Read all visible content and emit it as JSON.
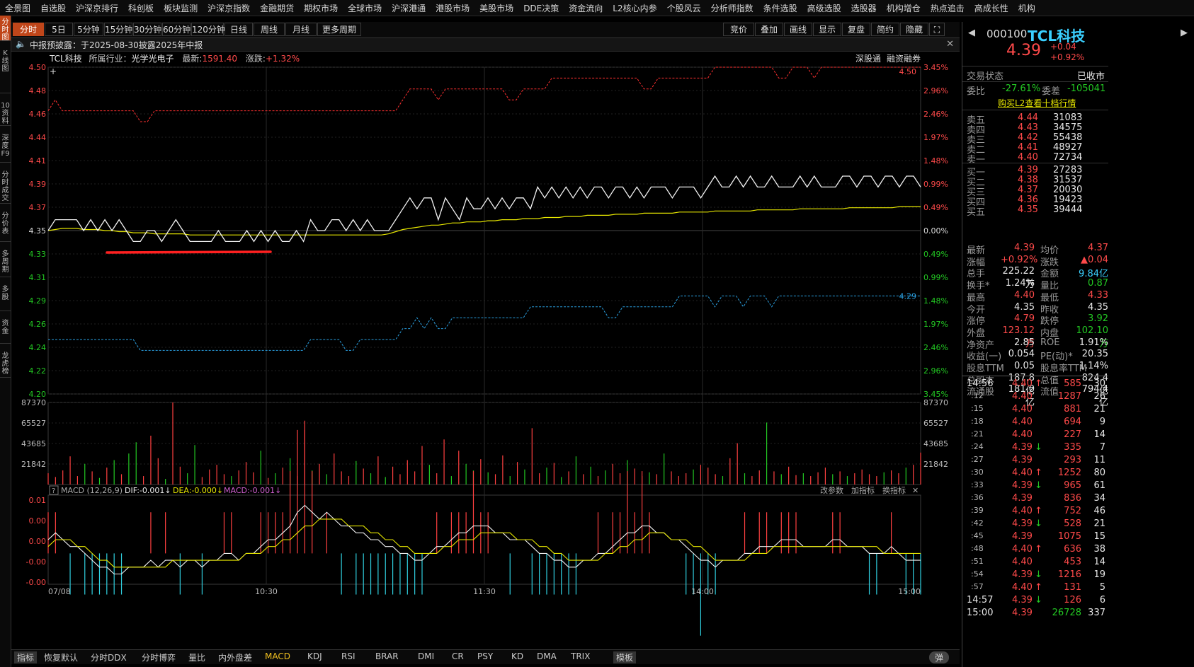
{
  "menu": [
    "全景图",
    "自选股",
    "沪深京排行",
    "科创板",
    "板块监测",
    "沪深京指数",
    "金融期货",
    "期权市场",
    "全球市场",
    "沪深港通",
    "港股市场",
    "美股市场",
    "DDE决策",
    "资金流向",
    "L2核心内参",
    "个股风云",
    "分析师指数",
    "条件选股",
    "高级选股",
    "选股器",
    "机构增仓",
    "热点追击",
    "高成长性",
    "机构"
  ],
  "left_tabs": [
    "分时图",
    "K线图",
    "10资料",
    "深度F9",
    "分时成交",
    "分价表",
    "多周期",
    "多股",
    "资金",
    "龙虎榜"
  ],
  "periods": [
    "分时",
    "5日",
    "5分钟",
    "15分钟",
    "30分钟",
    "60分钟",
    "120分钟",
    "日线",
    "周线",
    "月线",
    "更多周期"
  ],
  "right_tools": [
    "竞价",
    "叠加",
    "画线",
    "显示",
    "复盘",
    "简约",
    "隐藏",
    "⛶"
  ],
  "notice": {
    "text": "中报预披露：于2025-08-30披露2025年中报",
    "close": "✕"
  },
  "info": {
    "name": "TCL科技",
    "industry_label": "所属行业：",
    "industry": "光学光电子",
    "latest_label": "最新:",
    "latest": "1591.40",
    "change_label": "涨跌:",
    "change": "+1.32%",
    "link1": "深股通",
    "link2": "融资融券"
  },
  "price_axis": [
    "4.50",
    "4.48",
    "4.46",
    "4.44",
    "4.41",
    "4.39",
    "4.37",
    "4.35",
    "4.33",
    "4.31",
    "4.29",
    "4.26",
    "4.24",
    "4.22",
    "4.20"
  ],
  "pct_axis": [
    "3.45%",
    "2.96%",
    "2.46%",
    "1.97%",
    "1.48%",
    "0.99%",
    "0.49%",
    "0.00%",
    "0.49%",
    "0.99%",
    "1.48%",
    "1.97%",
    "2.46%",
    "2.96%",
    "3.45%"
  ],
  "vol_axis": [
    "87370",
    "65527",
    "43685",
    "21842"
  ],
  "macd_axis": [
    "0.01",
    "0.00",
    "0.00",
    "-0.00",
    "-0.00"
  ],
  "times": [
    "07/08",
    "10:30",
    "11:30",
    "14:00",
    "15:00"
  ],
  "marks": {
    "upper": "4.50",
    "lower": "4.29"
  },
  "macd": {
    "label": "MACD (12,26,9)",
    "dif": "DIF:-0.001↓",
    "dea": "DEA:-0.000↓",
    "macd": "MACD:-0.001↓",
    "btn1": "改参数",
    "btn2": "加指标",
    "btn3": "换指标"
  },
  "bottom_tabs": [
    "指标",
    "恢复默认",
    "分时DDX",
    "分时博弈",
    "量比",
    "内外盘差",
    "MACD",
    "KDJ",
    "RSI",
    "BRAR",
    "DMI",
    "CR",
    "PSY",
    "KD",
    "DMA",
    "TRIX",
    "模板"
  ],
  "bottom_toggle": "弹",
  "stock": {
    "code": "000100",
    "name": "TCL科技",
    "price": "4.39",
    "chg": "+0.04",
    "pct": "+0.92%"
  },
  "status": {
    "label": "交易状态",
    "value": "已收市"
  },
  "weibi": {
    "l1": "委比",
    "v1": "-27.61%",
    "l2": "委差",
    "v2": "-105041"
  },
  "l2link": "购买L2查看十档行情",
  "asks": [
    [
      "卖五",
      "4.44",
      "31083"
    ],
    [
      "卖四",
      "4.43",
      "34575"
    ],
    [
      "卖三",
      "4.42",
      "55438"
    ],
    [
      "卖二",
      "4.41",
      "48927"
    ],
    [
      "卖一",
      "4.40",
      "72734"
    ]
  ],
  "bids": [
    [
      "买一",
      "4.39",
      "27283"
    ],
    [
      "买二",
      "4.38",
      "31537"
    ],
    [
      "买三",
      "4.37",
      "20030"
    ],
    [
      "买四",
      "4.36",
      "19423"
    ],
    [
      "买五",
      "4.35",
      "39444"
    ]
  ],
  "stats": [
    [
      "最新",
      "4.39",
      "均价",
      "4.37"
    ],
    [
      "涨幅",
      "+0.92%",
      "涨跌",
      "▲0.04"
    ],
    [
      "总手",
      "225.22万",
      "金额",
      "9.84亿"
    ],
    [
      "换手*",
      "1.24%",
      "量比",
      "0.87"
    ],
    [
      "最高",
      "4.40",
      "最低",
      "4.33"
    ],
    [
      "今开",
      "4.35",
      "昨收",
      "4.35"
    ],
    [
      "涨停",
      "4.79",
      "跌停",
      "3.92"
    ],
    [
      "外盘",
      "123.12万",
      "内盘",
      "102.10万"
    ],
    [
      "净资产",
      "2.85",
      "ROE",
      "1.91%"
    ],
    [
      "收益(一)",
      "0.054",
      "PE(动)*",
      "20.35"
    ],
    [
      "股息TTM",
      "0.05",
      "股息率TTM",
      "1.14%"
    ],
    [
      "总股本",
      "187.8亿",
      "总值",
      "824.4亿"
    ],
    [
      "流通股",
      "181.0亿",
      "流值",
      "794.4亿"
    ]
  ],
  "ticks": [
    [
      "14:56",
      "4.40",
      "↑",
      "585",
      "30"
    ],
    [
      ":12",
      "4.40",
      "",
      "1287",
      "26"
    ],
    [
      ":15",
      "4.40",
      "",
      "881",
      "21"
    ],
    [
      ":18",
      "4.40",
      "",
      "694",
      "9"
    ],
    [
      ":21",
      "4.40",
      "",
      "227",
      "14"
    ],
    [
      ":24",
      "4.39",
      "↓",
      "335",
      "7"
    ],
    [
      ":27",
      "4.39",
      "",
      "293",
      "11"
    ],
    [
      ":30",
      "4.40",
      "↑",
      "1252",
      "80"
    ],
    [
      ":33",
      "4.39",
      "↓",
      "965",
      "61"
    ],
    [
      ":36",
      "4.39",
      "",
      "836",
      "34"
    ],
    [
      ":39",
      "4.40",
      "↑",
      "752",
      "46"
    ],
    [
      ":42",
      "4.39",
      "↓",
      "528",
      "21"
    ],
    [
      ":45",
      "4.39",
      "",
      "1075",
      "15"
    ],
    [
      ":48",
      "4.40",
      "↑",
      "636",
      "38"
    ],
    [
      ":51",
      "4.40",
      "",
      "453",
      "14"
    ],
    [
      ":54",
      "4.39",
      "↓",
      "1216",
      "19"
    ],
    [
      ":57",
      "4.40",
      "↑",
      "131",
      "5"
    ],
    [
      "14:57",
      "4.39",
      "↓",
      "126",
      "6"
    ],
    [
      "15:00",
      "4.39",
      "",
      "26728",
      "337"
    ]
  ],
  "chart_data": {
    "type": "line",
    "title": "TCL科技 分时",
    "prev_close": 4.35,
    "ylim": [
      4.2,
      4.5
    ],
    "x_ticks": [
      "07/08",
      "10:30",
      "11:30",
      "14:00",
      "15:00"
    ],
    "price": [
      4.35,
      4.36,
      4.36,
      4.36,
      4.36,
      4.35,
      4.36,
      4.35,
      4.36,
      4.35,
      4.36,
      4.35,
      4.34,
      4.34,
      4.35,
      4.35,
      4.34,
      4.35,
      4.36,
      4.35,
      4.34,
      4.34,
      4.34,
      4.34,
      4.35,
      4.34,
      4.34,
      4.34,
      4.35,
      4.34,
      4.35,
      4.34,
      4.35,
      4.34,
      4.34,
      4.35,
      4.34,
      4.36,
      4.35,
      4.35,
      4.36,
      4.36,
      4.35,
      4.36,
      4.35,
      4.36,
      4.35,
      4.35,
      4.35,
      4.36,
      4.37,
      4.38,
      4.37,
      4.38,
      4.38,
      4.36,
      4.38,
      4.37,
      4.36,
      4.38,
      4.37,
      4.37,
      4.38,
      4.37,
      4.38,
      4.37,
      4.38,
      4.38,
      4.37,
      4.39,
      4.38,
      4.39,
      4.38,
      4.39,
      4.38,
      4.39,
      4.38,
      4.39,
      4.39,
      4.38,
      4.39,
      4.39,
      4.38,
      4.39,
      4.38,
      4.39,
      4.39,
      4.39,
      4.38,
      4.39,
      4.39,
      4.39,
      4.38,
      4.39,
      4.4,
      4.39,
      4.39,
      4.4,
      4.39,
      4.4,
      4.39,
      4.39,
      4.4,
      4.39,
      4.39,
      4.39,
      4.4,
      4.39,
      4.4,
      4.39,
      4.39,
      4.39,
      4.4,
      4.4,
      4.39,
      4.4,
      4.4,
      4.39,
      4.4,
      4.4,
      4.39,
      4.4,
      4.4,
      4.39
    ],
    "avg": [
      4.35,
      4.351,
      4.352,
      4.352,
      4.352,
      4.351,
      4.351,
      4.351,
      4.35,
      4.35,
      4.349,
      4.349,
      4.348,
      4.348,
      4.348,
      4.347,
      4.347,
      4.347,
      4.347,
      4.347,
      4.346,
      4.346,
      4.346,
      4.346,
      4.346,
      4.346,
      4.346,
      4.346,
      4.346,
      4.346,
      4.346,
      4.346,
      4.346,
      4.346,
      4.346,
      4.346,
      4.346,
      4.346,
      4.346,
      4.346,
      4.346,
      4.346,
      4.346,
      4.346,
      4.346,
      4.346,
      4.346,
      4.346,
      4.347,
      4.349,
      4.351,
      4.352,
      4.353,
      4.354,
      4.355,
      4.355,
      4.356,
      4.357,
      4.357,
      4.358,
      4.358,
      4.358,
      4.359,
      4.359,
      4.36,
      4.36,
      4.36,
      4.361,
      4.361,
      4.361,
      4.362,
      4.362,
      4.362,
      4.363,
      4.363,
      4.363,
      4.364,
      4.364,
      4.364,
      4.364,
      4.365,
      4.365,
      4.365,
      4.365,
      4.366,
      4.366,
      4.366,
      4.366,
      4.366,
      4.367,
      4.367,
      4.367,
      4.367,
      4.367,
      4.368,
      4.368,
      4.368,
      4.368,
      4.368,
      4.368,
      4.369,
      4.369,
      4.369,
      4.369,
      4.369,
      4.369,
      4.37,
      4.37,
      4.37,
      4.37,
      4.37,
      4.37,
      4.37,
      4.371,
      4.371,
      4.371,
      4.371,
      4.371,
      4.371,
      4.371,
      4.372,
      4.372,
      4.372,
      4.372
    ],
    "upper_band": [
      4.46,
      4.47,
      4.46,
      4.46,
      4.46,
      4.46,
      4.46,
      4.46,
      4.46,
      4.46,
      4.46,
      4.46,
      4.46,
      4.45,
      4.45,
      4.46,
      4.46,
      4.46,
      4.46,
      4.46,
      4.46,
      4.46,
      4.46,
      4.46,
      4.46,
      4.46,
      4.46,
      4.46,
      4.46,
      4.46,
      4.46,
      4.46,
      4.46,
      4.46,
      4.46,
      4.46,
      4.46,
      4.46,
      4.46,
      4.46,
      4.46,
      4.46,
      4.46,
      4.46,
      4.46,
      4.46,
      4.46,
      4.46,
      4.46,
      4.46,
      4.47,
      4.48,
      4.48,
      4.48,
      4.48,
      4.47,
      4.48,
      4.48,
      4.48,
      4.48,
      4.48,
      4.48,
      4.48,
      4.48,
      4.48,
      4.47,
      4.47,
      4.48,
      4.48,
      4.48,
      4.48,
      4.49,
      4.49,
      4.49,
      4.49,
      4.49,
      4.49,
      4.49,
      4.49,
      4.49,
      4.49,
      4.49,
      4.49,
      4.49,
      4.48,
      4.48,
      4.49,
      4.49,
      4.49,
      4.49,
      4.49,
      4.49,
      4.49,
      4.49,
      4.5,
      4.5,
      4.5,
      4.5,
      4.5,
      4.5,
      4.5,
      4.5,
      4.5,
      4.49,
      4.49,
      4.5,
      4.5,
      4.5,
      4.49,
      4.5,
      4.5,
      4.5,
      4.5,
      4.5,
      4.5,
      4.5,
      4.5,
      4.5,
      4.5,
      4.5,
      4.5,
      4.5,
      4.5,
      4.5
    ],
    "lower_band": [
      4.25,
      4.25,
      4.25,
      4.25,
      4.25,
      4.25,
      4.25,
      4.25,
      4.25,
      4.25,
      4.25,
      4.25,
      4.25,
      4.24,
      4.24,
      4.24,
      4.24,
      4.24,
      4.24,
      4.24,
      4.24,
      4.24,
      4.24,
      4.24,
      4.24,
      4.24,
      4.24,
      4.24,
      4.24,
      4.24,
      4.24,
      4.24,
      4.24,
      4.24,
      4.24,
      4.24,
      4.24,
      4.25,
      4.25,
      4.25,
      4.25,
      4.25,
      4.24,
      4.24,
      4.25,
      4.25,
      4.25,
      4.25,
      4.25,
      4.25,
      4.26,
      4.26,
      4.27,
      4.26,
      4.27,
      4.26,
      4.26,
      4.27,
      4.27,
      4.27,
      4.27,
      4.27,
      4.27,
      4.27,
      4.27,
      4.27,
      4.27,
      4.27,
      4.28,
      4.28,
      4.28,
      4.28,
      4.28,
      4.28,
      4.28,
      4.28,
      4.28,
      4.28,
      4.28,
      4.27,
      4.27,
      4.28,
      4.28,
      4.28,
      4.28,
      4.28,
      4.28,
      4.28,
      4.28,
      4.29,
      4.29,
      4.29,
      4.29,
      4.29,
      4.28,
      4.29,
      4.29,
      4.29,
      4.28,
      4.29,
      4.29,
      4.29,
      4.28,
      4.29,
      4.29,
      4.29,
      4.29,
      4.29,
      4.29,
      4.29,
      4.29,
      4.29,
      4.29,
      4.29,
      4.29,
      4.29,
      4.29,
      4.29,
      4.29,
      4.29,
      4.29,
      4.29,
      4.29,
      4.29
    ],
    "volume": [
      12000,
      8000,
      15000,
      30000,
      9000,
      22000,
      14000,
      7000,
      18000,
      26000,
      11000,
      33000,
      45000,
      9000,
      52000,
      28000,
      6000,
      87370,
      19000,
      12000,
      42000,
      8000,
      16000,
      21000,
      11000,
      9000,
      15000,
      24000,
      13000,
      36000,
      7000,
      12000,
      18000,
      28000,
      9000,
      68000,
      15000,
      22000,
      11000,
      33000,
      14000,
      9000,
      25000,
      17000,
      12000,
      30000,
      8000,
      19000,
      11000,
      26000,
      14000,
      41000,
      21000,
      12000,
      48000,
      9000,
      36000,
      22000,
      15000,
      27000,
      13000,
      11000,
      31000,
      9000,
      24000,
      16000,
      60000,
      12000,
      18000,
      23000,
      8000,
      14000,
      30000,
      11000,
      19000,
      9000,
      15000,
      22000,
      12000,
      26000,
      17000,
      9000,
      13000,
      11000,
      33000,
      14000,
      9000,
      12000,
      16000,
      21000,
      18000,
      11000,
      9000,
      28000,
      44000,
      12000,
      9000,
      15000,
      66000,
      14000,
      11000,
      19000,
      10000,
      12000,
      9000,
      13000,
      18000,
      11000,
      14000,
      9000,
      12000,
      16000,
      11000,
      9000,
      13000,
      15000,
      12000,
      18000,
      21000,
      34000
    ],
    "dif": [
      0.002,
      0.003,
      0.002,
      0.001,
      0.001,
      0.0,
      -0.001,
      -0.002,
      -0.002,
      -0.003,
      -0.003,
      -0.002,
      -0.002,
      -0.002,
      -0.001,
      -0.002,
      -0.001,
      -0.001,
      -0.002,
      -0.001,
      -0.001,
      -0.002,
      -0.001,
      -0.001,
      0.0,
      0.0,
      -0.001,
      0.0,
      0.0,
      0.001,
      0.002,
      0.002,
      0.003,
      0.004,
      0.006,
      0.007,
      0.006,
      0.005,
      0.006,
      0.005,
      0.004,
      0.004,
      0.003,
      0.003,
      0.002,
      0.002,
      0.001,
      0.001,
      0.0,
      0.0,
      -0.001,
      -0.001,
      0.0,
      0.001,
      0.001,
      0.002,
      0.003,
      0.003,
      0.004,
      0.004,
      0.004,
      0.003,
      0.003,
      0.002,
      0.002,
      0.002,
      0.001,
      0.0,
      0.0,
      -0.001,
      -0.001,
      -0.002,
      -0.002,
      -0.001,
      -0.001,
      0.0,
      0.0,
      0.001,
      0.002,
      0.003,
      0.003,
      0.004,
      0.004,
      0.003,
      0.003,
      0.002,
      0.002,
      0.001,
      0.0,
      -0.001,
      -0.001,
      -0.002,
      -0.001,
      -0.001,
      -0.001,
      0.0,
      0.0,
      0.001,
      0.001,
      0.001,
      0.002,
      0.002,
      0.002,
      0.001,
      0.001,
      0.001,
      0.001,
      0.002,
      0.002,
      0.001,
      0.001,
      0.001,
      0.0,
      0.0,
      0.0,
      0.001,
      0.0,
      -0.001,
      -0.001,
      -0.001
    ],
    "dea": [
      0.001,
      0.002,
      0.002,
      0.002,
      0.001,
      0.001,
      0.0,
      -0.001,
      -0.001,
      -0.002,
      -0.002,
      -0.002,
      -0.002,
      -0.002,
      -0.002,
      -0.002,
      -0.002,
      -0.001,
      -0.001,
      -0.001,
      -0.001,
      -0.001,
      -0.001,
      -0.001,
      -0.001,
      -0.001,
      -0.001,
      0.0,
      0.0,
      0.0,
      0.001,
      0.001,
      0.002,
      0.002,
      0.003,
      0.004,
      0.004,
      0.005,
      0.005,
      0.005,
      0.005,
      0.004,
      0.004,
      0.004,
      0.003,
      0.003,
      0.002,
      0.002,
      0.001,
      0.001,
      0.0,
      0.0,
      0.0,
      0.0,
      0.001,
      0.001,
      0.002,
      0.002,
      0.002,
      0.003,
      0.003,
      0.003,
      0.003,
      0.003,
      0.002,
      0.002,
      0.002,
      0.001,
      0.001,
      0.0,
      0.0,
      -0.001,
      -0.001,
      -0.001,
      -0.001,
      -0.001,
      0.0,
      0.0,
      0.001,
      0.001,
      0.002,
      0.002,
      0.003,
      0.003,
      0.003,
      0.002,
      0.002,
      0.002,
      0.001,
      0.001,
      0.0,
      -0.001,
      -0.001,
      -0.001,
      -0.001,
      -0.001,
      0.0,
      0.0,
      0.0,
      0.001,
      0.001,
      0.001,
      0.001,
      0.001,
      0.001,
      0.001,
      0.001,
      0.001,
      0.001,
      0.001,
      0.001,
      0.001,
      0.001,
      0.001,
      0.0,
      0.0,
      0.0,
      0.0,
      0.0,
      0.0
    ]
  }
}
